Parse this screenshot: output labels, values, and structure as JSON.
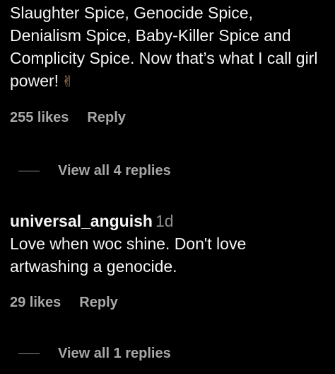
{
  "comments": [
    {
      "text": "Slaughter Spice, Genocide Spice, Denialism Spice, Baby-Killer Spice and Complicity Spice. Now that’s what I call girl power!",
      "emoji": "✌",
      "likes": "255 likes",
      "reply_label": "Reply",
      "view_replies": "View all 4 replies"
    },
    {
      "username": "universal_anguish",
      "time": "1d",
      "text": "Love when woc shine. Don't love artwashing a genocide.",
      "likes": "29 likes",
      "reply_label": "Reply",
      "view_replies": "View all 1 replies"
    }
  ],
  "colors": {
    "background": "#000000",
    "text": "#f5f5f5",
    "secondary": "#a8a8a8",
    "muted": "#8e8e8e"
  }
}
